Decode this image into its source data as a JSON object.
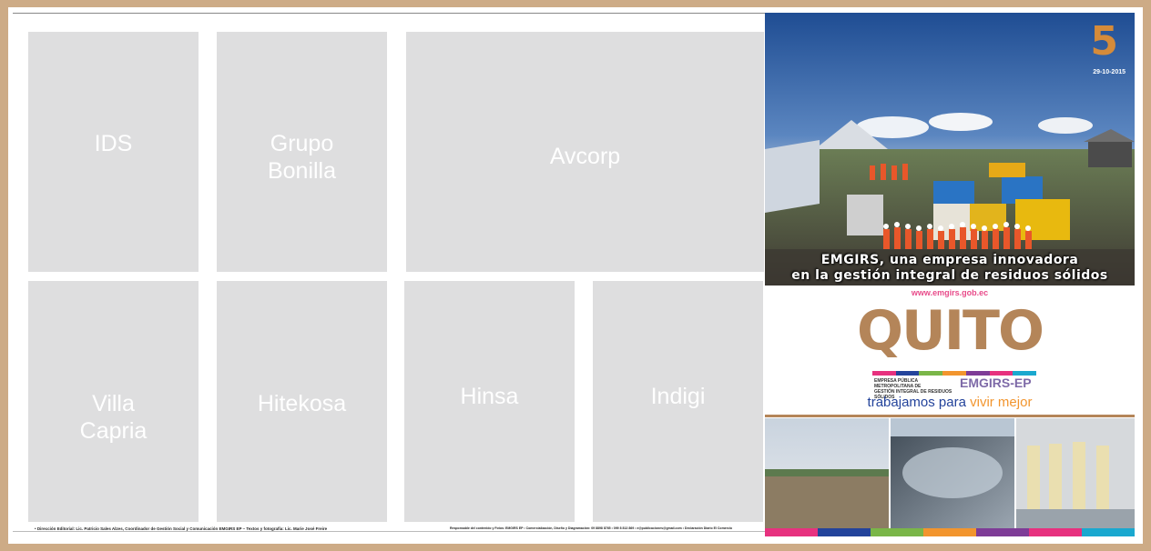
{
  "placeholders": {
    "ids": "IDS",
    "grupo_bonilla": "Grupo\nBonilla",
    "avcorp": "Avcorp",
    "villa_capria": "Villa\nCapria",
    "hitekosa": "Hitekosa",
    "hinsa": "Hinsa",
    "indigi": "Indigi"
  },
  "footer": {
    "left": "• Dirección Editorial: Lic. Patricio Sales Alzes, Coordinador de Gestión Social y Comunicación EMGIRS EP – Textos y fotografía: Lic. Marie José Freire",
    "right": "Responsable del contenido y Fotos: EMGIRS EP • Comercialización, Diseño y Diagramación: 09 8898 8765 • 099 8 813 869 • e@publicaciones@gmail.com • Declaración Diario El Comercio"
  },
  "ad": {
    "anniversary_number": "5",
    "anniversary_date": "29-10-2015",
    "caption_line1": "EMGIRS, una empresa innovadora",
    "caption_line2": "en la gestión integral de residuos sólidos",
    "url": "www.emgirs.gob.ec",
    "brand": "QUITO",
    "agency_line1": "EMPRESA PÚBLICA METROPOLITANA DE",
    "agency_line2": "GESTIÓN INTEGRAL DE RESIDUOS SÓLIDOS",
    "agency_short": "EMGIRS-EP",
    "slogan_a": "trabajamos para ",
    "slogan_b": "vivir mejor"
  },
  "colors": {
    "placeholder": "#dededf",
    "background": "#cdab86",
    "brand_gold": "#b48559",
    "slogan_blue": "#23439b",
    "slogan_orange": "#f2952e",
    "stripe": [
      "#e7317f",
      "#23439b",
      "#7ab648",
      "#f2952e",
      "#7e3c97",
      "#e7317f",
      "#1aa8cf"
    ]
  }
}
